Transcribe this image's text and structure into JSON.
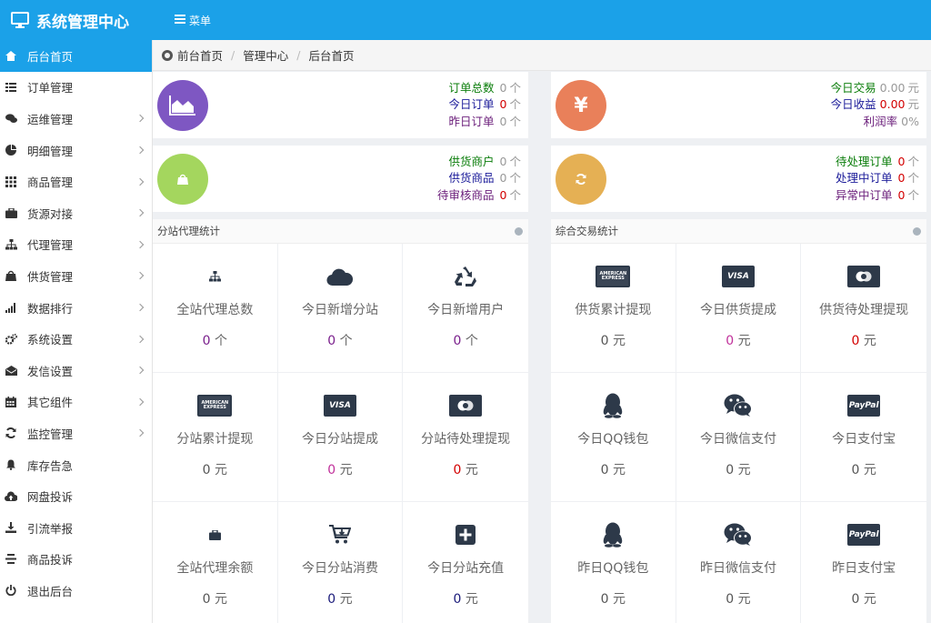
{
  "header": {
    "title": "系统管理中心",
    "menu_label": "菜单"
  },
  "sidebar": {
    "items": [
      {
        "label": "后台首页",
        "icon": "home-icon",
        "active": true,
        "chevron": false
      },
      {
        "label": "订单管理",
        "icon": "list-icon",
        "active": false,
        "chevron": false
      },
      {
        "label": "运维管理",
        "icon": "comments-icon",
        "active": false,
        "chevron": true
      },
      {
        "label": "明细管理",
        "icon": "pie-chart-icon",
        "active": false,
        "chevron": true
      },
      {
        "label": "商品管理",
        "icon": "grid-icon",
        "active": false,
        "chevron": true
      },
      {
        "label": "货源对接",
        "icon": "briefcase-icon",
        "active": false,
        "chevron": true
      },
      {
        "label": "代理管理",
        "icon": "sitemap-icon",
        "active": false,
        "chevron": true
      },
      {
        "label": "供货管理",
        "icon": "shopping-bag-icon",
        "active": false,
        "chevron": true
      },
      {
        "label": "数据排行",
        "icon": "signal-icon",
        "active": false,
        "chevron": true
      },
      {
        "label": "系统设置",
        "icon": "cogs-icon",
        "active": false,
        "chevron": true
      },
      {
        "label": "发信设置",
        "icon": "envelope-icon",
        "active": false,
        "chevron": true
      },
      {
        "label": "其它组件",
        "icon": "calendar-icon",
        "active": false,
        "chevron": true
      },
      {
        "label": "监控管理",
        "icon": "refresh-icon",
        "active": false,
        "chevron": true
      },
      {
        "label": "库存告急",
        "icon": "bell-icon",
        "active": false,
        "chevron": false
      },
      {
        "label": "网盘投诉",
        "icon": "cloud-upload-icon",
        "active": false,
        "chevron": false
      },
      {
        "label": "引流举报",
        "icon": "download-icon",
        "active": false,
        "chevron": false
      },
      {
        "label": "商品投诉",
        "icon": "align-icon",
        "active": false,
        "chevron": false
      },
      {
        "label": "退出后台",
        "icon": "power-icon",
        "active": false,
        "chevron": false
      }
    ]
  },
  "breadcrumb": {
    "items": [
      "前台首页",
      "管理中心",
      "后台首页"
    ]
  },
  "stats": {
    "orders": {
      "icon": "area-chart-icon",
      "color": "#7e57c2",
      "rows": [
        {
          "label": "订单总数",
          "value": "0",
          "unit": "个",
          "color": "g",
          "red": false
        },
        {
          "label": "今日订单",
          "value": "0",
          "unit": "个",
          "color": "b",
          "red": true
        },
        {
          "label": "昨日订单",
          "value": "0",
          "unit": "个",
          "color": "p",
          "red": false
        }
      ]
    },
    "trade": {
      "icon": "yen-icon",
      "color": "#e9805a",
      "rows": [
        {
          "label": "今日交易",
          "value": "0.00",
          "unit": "元",
          "color": "g",
          "red": false
        },
        {
          "label": "今日收益",
          "value": "0.00",
          "unit": "元",
          "color": "b",
          "red": true
        },
        {
          "label": "利润率",
          "value": "0%",
          "unit": "",
          "color": "p",
          "red": false
        }
      ]
    },
    "suppliers": {
      "icon": "shopping-bag-icon",
      "color": "#a4d65e",
      "rows": [
        {
          "label": "供货商户",
          "value": "0",
          "unit": "个",
          "color": "g",
          "red": false
        },
        {
          "label": "供货商品",
          "value": "0",
          "unit": "个",
          "color": "b",
          "red": false
        },
        {
          "label": "待审核商品",
          "value": "0",
          "unit": "个",
          "color": "p",
          "red": true
        }
      ]
    },
    "pending": {
      "icon": "refresh-icon",
      "color": "#e5b054",
      "rows": [
        {
          "label": "待处理订单",
          "value": "0",
          "unit": "个",
          "color": "g",
          "red": true
        },
        {
          "label": "处理中订单",
          "value": "0",
          "unit": "个",
          "color": "b",
          "red": true
        },
        {
          "label": "异常中订单",
          "value": "0",
          "unit": "个",
          "color": "p",
          "red": true
        }
      ]
    }
  },
  "agent_panel": {
    "title": "分站代理统计",
    "cells": [
      {
        "icon": "sitemap-icon",
        "title": "全站代理总数",
        "value": "0",
        "unit": "个",
        "value_color": "num-purple"
      },
      {
        "icon": "cloud-icon",
        "title": "今日新增分站",
        "value": "0",
        "unit": "个",
        "value_color": "num-purple"
      },
      {
        "icon": "recycle-icon",
        "title": "今日新增用户",
        "value": "0",
        "unit": "个",
        "value_color": "num-purple"
      },
      {
        "icon": "amex-card-icon",
        "title": "分站累计提现",
        "value": "0",
        "unit": "元",
        "value_color": "num-gray"
      },
      {
        "icon": "visa-card-icon",
        "title": "今日分站提成",
        "value": "0",
        "unit": "元",
        "value_color": "num-magenta"
      },
      {
        "icon": "mastercard-icon",
        "title": "分站待处理提现",
        "value": "0",
        "unit": "元",
        "value_color": "num-red"
      },
      {
        "icon": "briefcase-icon",
        "title": "全站代理余额",
        "value": "0",
        "unit": "元",
        "value_color": "num-gray"
      },
      {
        "icon": "cart-icon",
        "title": "今日分站消费",
        "value": "0",
        "unit": "元",
        "value_color": "num-navy"
      },
      {
        "icon": "plus-square-icon",
        "title": "今日分站充值",
        "value": "0",
        "unit": "元",
        "value_color": "num-navy"
      }
    ]
  },
  "trade_panel": {
    "title": "综合交易统计",
    "cells": [
      {
        "icon": "amex-card-icon",
        "title": "供货累计提现",
        "value": "0",
        "unit": "元",
        "value_color": "num-gray"
      },
      {
        "icon": "visa-card-icon",
        "title": "今日供货提成",
        "value": "0",
        "unit": "元",
        "value_color": "num-magenta"
      },
      {
        "icon": "mastercard-icon",
        "title": "供货待处理提现",
        "value": "0",
        "unit": "元",
        "value_color": "num-red"
      },
      {
        "icon": "qq-icon",
        "title": "今日QQ钱包",
        "value": "0",
        "unit": "元",
        "value_color": "num-gray"
      },
      {
        "icon": "wechat-icon",
        "title": "今日微信支付",
        "value": "0",
        "unit": "元",
        "value_color": "num-gray"
      },
      {
        "icon": "paypal-icon",
        "title": "今日支付宝",
        "value": "0",
        "unit": "元",
        "value_color": "num-gray"
      },
      {
        "icon": "qq-icon",
        "title": "昨日QQ钱包",
        "value": "0",
        "unit": "元",
        "value_color": "num-gray"
      },
      {
        "icon": "wechat-icon",
        "title": "昨日微信支付",
        "value": "0",
        "unit": "元",
        "value_color": "num-gray"
      },
      {
        "icon": "paypal-icon",
        "title": "昨日支付宝",
        "value": "0",
        "unit": "元",
        "value_color": "num-gray"
      }
    ]
  },
  "card_text": {
    "amex": "AMERICAN EXPRESS",
    "visa": "VISA",
    "paypal": "PayPal"
  }
}
